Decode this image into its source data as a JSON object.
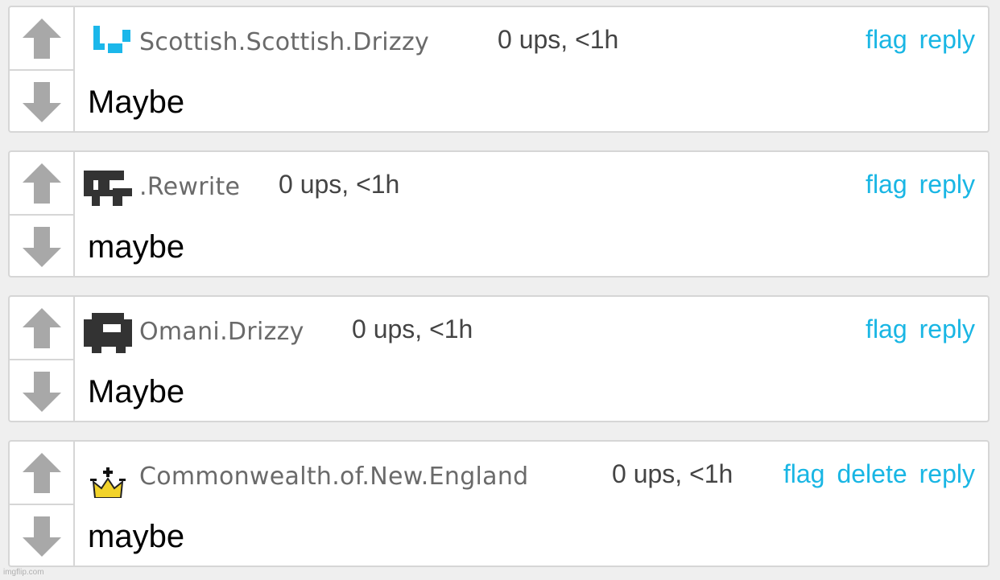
{
  "comments": [
    {
      "username": "Scottish.Scottish.Drizzy",
      "meta": "0 ups, <1h",
      "actions": [
        "flag",
        "reply"
      ],
      "body": "Maybe",
      "avatar_icon": "blue-bracket-avatar-icon"
    },
    {
      "username": ".Rewrite",
      "meta": "0 ups, <1h",
      "actions": [
        "flag",
        "reply"
      ],
      "body": "maybe",
      "avatar_icon": "pixel-skull-avatar-icon"
    },
    {
      "username": "Omani.Drizzy",
      "meta": "0 ups, <1h",
      "actions": [
        "flag",
        "reply"
      ],
      "body": "Maybe",
      "avatar_icon": "pixel-block-avatar-icon"
    },
    {
      "username": "Commonwealth.of.New.England",
      "meta": "0 ups, <1h",
      "actions": [
        "flag",
        "delete",
        "reply"
      ],
      "body": "maybe",
      "avatar_icon": "crown-avatar-icon"
    }
  ],
  "watermark": "imgflip.com",
  "colors": {
    "link": "#19b6e4",
    "username": "#6a6a6a",
    "arrow": "#a8a8a8",
    "border": "#d6d6d6",
    "background": "#efefef"
  }
}
